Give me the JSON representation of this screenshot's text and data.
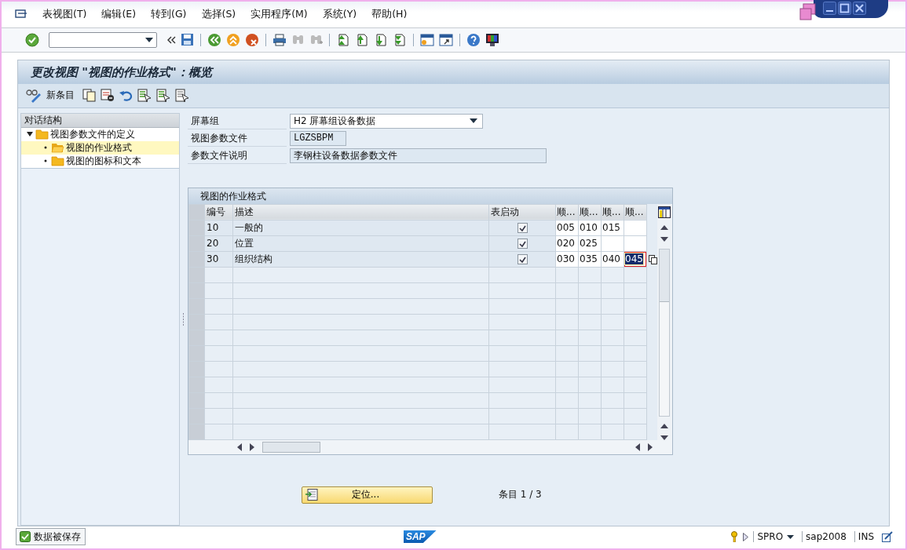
{
  "menu": [
    {
      "label": "表视图(T)"
    },
    {
      "label": "编辑(E)"
    },
    {
      "label": "转到(G)"
    },
    {
      "label": "选择(S)"
    },
    {
      "label": "实用程序(M)"
    },
    {
      "label": "系统(Y)"
    },
    {
      "label": "帮助(H)"
    }
  ],
  "title": "更改视图 \"视图的作业格式\"：概览",
  "app_toolbar": {
    "new_entries": "新条目"
  },
  "tree": {
    "header": "对话结构",
    "items": [
      {
        "label": "视图参数文件的定义",
        "selected": false,
        "expanded": true,
        "children": [
          {
            "label": "视图的作业格式",
            "selected": true
          },
          {
            "label": "视图的图标和文本",
            "selected": false
          }
        ]
      }
    ]
  },
  "fields": [
    {
      "label": "屏幕组",
      "value": "H2 屏幕组设备数据",
      "kind": "dropdown"
    },
    {
      "label": "视图参数文件",
      "value": "LGZSBPM",
      "kind": "code"
    },
    {
      "label": "参数文件说明",
      "value": "李钢柱设备数据参数文件",
      "kind": "text"
    }
  ],
  "table": {
    "title": "视图的作业格式",
    "columns": [
      {
        "label": "编号"
      },
      {
        "label": "描述"
      },
      {
        "label": "表启动"
      },
      {
        "label": "顺..."
      },
      {
        "label": "顺..."
      },
      {
        "label": "顺..."
      },
      {
        "label": "顺..."
      }
    ],
    "rows": [
      {
        "number": "10",
        "description": "一般的",
        "table_start": true,
        "sequence": [
          {
            "value": "005",
            "focused": false
          },
          {
            "value": "010",
            "focused": false
          },
          {
            "value": "015",
            "focused": false
          }
        ]
      },
      {
        "number": "20",
        "description": "位置",
        "table_start": true,
        "sequence": [
          {
            "value": "020",
            "focused": false
          },
          {
            "value": "025",
            "focused": false
          }
        ]
      },
      {
        "number": "30",
        "description": "组织结构",
        "table_start": true,
        "sequence": [
          {
            "value": "030",
            "focused": false
          },
          {
            "value": "035",
            "focused": false
          },
          {
            "value": "040",
            "focused": false
          },
          {
            "value": "045",
            "focused": true
          }
        ]
      }
    ]
  },
  "position_button": "定位...",
  "entry_count": "条目 1 / 3",
  "status": {
    "message": "数据被保存",
    "kind": "success",
    "logo": "SAP",
    "transaction": "SPRO",
    "system": "sap2008",
    "mode": "INS"
  }
}
